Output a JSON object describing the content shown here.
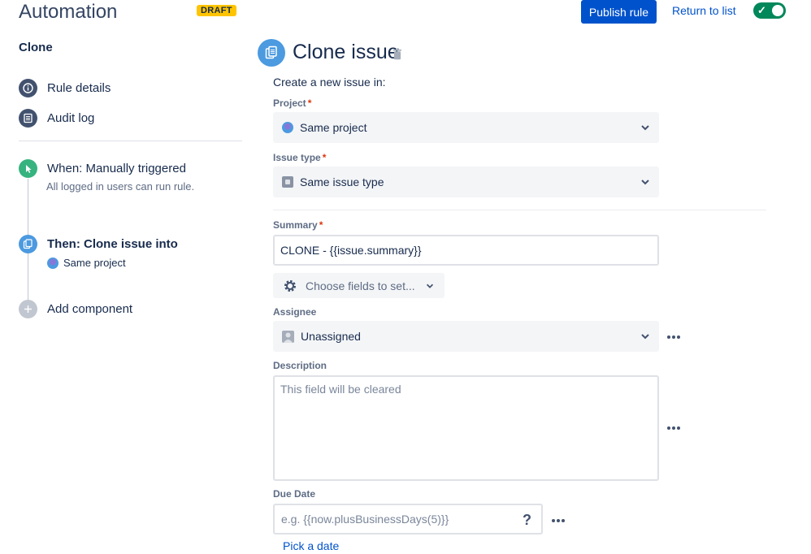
{
  "header": {
    "app_title": "Automation",
    "status_badge": "DRAFT",
    "publish_label": "Publish rule",
    "return_label": "Return to list",
    "toggle_state": "on",
    "toggle_color": "#00875a",
    "primary_color": "#0052cc"
  },
  "sidebar": {
    "rule_name": "Clone",
    "nav": [
      {
        "label": "Rule details",
        "icon": "info-icon"
      },
      {
        "label": "Audit log",
        "icon": "list-icon"
      }
    ],
    "trigger": {
      "title": "When: Manually triggered",
      "subtitle": "All logged in users can run rule.",
      "icon": "cursor-click-icon"
    },
    "action": {
      "title": "Then: Clone issue into",
      "subtitle": "Same project",
      "icon": "clone-icon"
    },
    "add_component": "Add component"
  },
  "main": {
    "title": "Clone issue",
    "intro": "Create a new issue in:",
    "project": {
      "label": "Project",
      "required": "*",
      "value": "Same project"
    },
    "issue_type": {
      "label": "Issue type",
      "required": "*",
      "value": "Same issue type"
    },
    "summary": {
      "label": "Summary",
      "required": "*",
      "value": "CLONE - {{issue.summary}}"
    },
    "choose_fields": "Choose fields to set...",
    "assignee": {
      "label": "Assignee",
      "value": "Unassigned"
    },
    "description": {
      "label": "Description",
      "placeholder": "This field will be cleared"
    },
    "due_date": {
      "label": "Due Date",
      "placeholder": "e.g. {{now.plusBusinessDays(5)}}",
      "help": "?"
    },
    "pick_date": "Pick a date"
  }
}
